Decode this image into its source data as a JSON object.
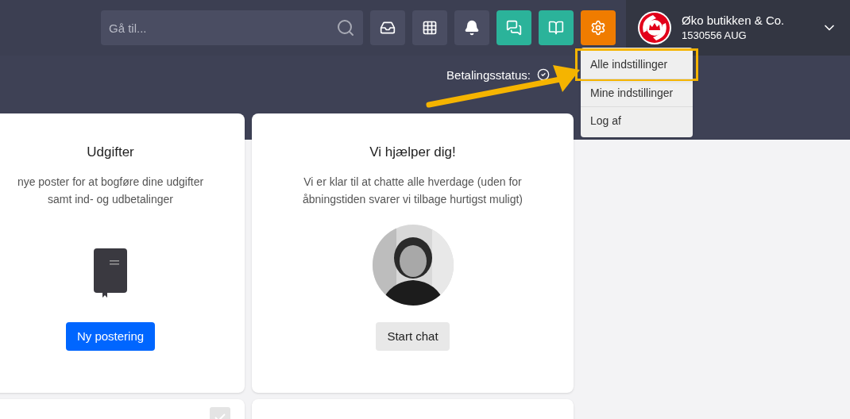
{
  "topbar": {
    "search": {
      "placeholder": "Gå til..."
    },
    "toolbar": [
      {
        "kind": "inbox",
        "color": "#4a4d62"
      },
      {
        "kind": "apps",
        "color": "#4a4d62"
      },
      {
        "kind": "bell",
        "color": "#4a4d62"
      },
      {
        "kind": "chat",
        "color": "#2bb39a"
      },
      {
        "kind": "book",
        "color": "#2bb39a"
      },
      {
        "kind": "gear",
        "color": "#f07c00"
      }
    ],
    "company": {
      "name": "Øko butikken & Co.",
      "id": "1530556 AUG"
    }
  },
  "settings_menu": [
    {
      "label": "Alle indstillinger",
      "highlighted": true
    },
    {
      "label": "Mine indstillinger",
      "highlighted": false
    },
    {
      "label": "Log af",
      "highlighted": false
    }
  ],
  "status": {
    "label": "Betalingsstatus:"
  },
  "cards": [
    {
      "kind": "book",
      "title": "Udgifter",
      "text": [
        "nye poster for at bogføre dine udgifter",
        "samt ind- og udbetalinger"
      ],
      "button": "Ny postering",
      "primary": true
    },
    {
      "title": "Vi hjælper dig!",
      "text": [
        "Vi er klar til at chatte alle hverdage (uden for",
        "åbningstiden svarer vi tilbage hurtigst muligt)"
      ],
      "button": "Start chat",
      "primary": false
    }
  ]
}
